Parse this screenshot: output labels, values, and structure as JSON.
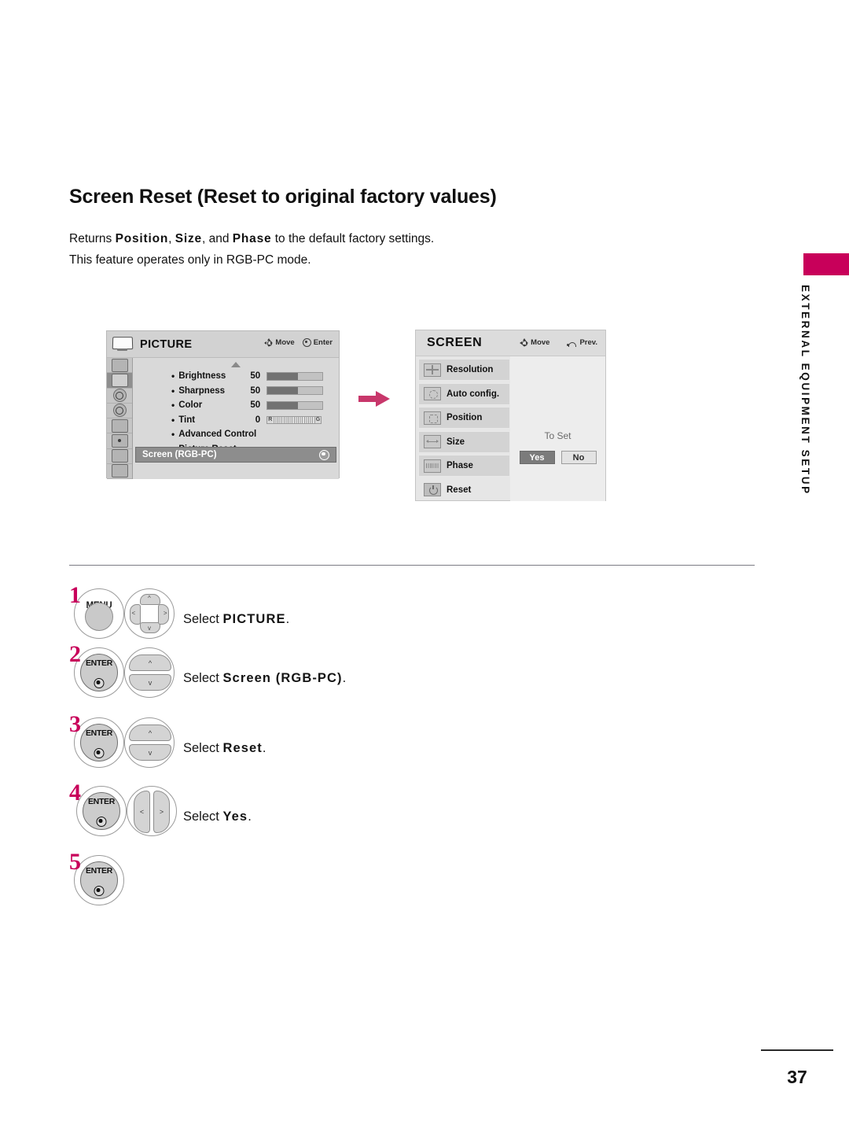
{
  "page": {
    "title": "Screen Reset (Reset to original factory values)",
    "intro_line1_prefix": "Returns ",
    "intro_bold_1": "Position",
    "intro_sep_1": ", ",
    "intro_bold_2": "Size",
    "intro_sep_2": ", and ",
    "intro_bold_3": "Phase",
    "intro_line1_suffix": " to the default factory settings.",
    "intro_line2": "This feature operates only in RGB-PC mode.",
    "running_head": "EXTERNAL EQUIPMENT SETUP",
    "page_number": "37",
    "accent_color": "#C8005A"
  },
  "osd_picture": {
    "title": "PICTURE",
    "tv_icon": "tv-icon",
    "hints": [
      {
        "icon": "dpad-icon",
        "label": "Move"
      },
      {
        "icon": "enter-icon",
        "label": "Enter"
      }
    ],
    "rail_icons": [
      "setup-icon",
      "picture-icon",
      "audio-icon",
      "time-icon",
      "option-icon",
      "lock-icon",
      "input-icon",
      "usb-icon"
    ],
    "rail_active_index": 1,
    "scroll_up_caret": "up-caret-icon",
    "rows": [
      {
        "label": "Brightness",
        "value": "50",
        "fill_pct": 55,
        "type": "bar"
      },
      {
        "label": "Sharpness",
        "value": "50",
        "fill_pct": 55,
        "type": "bar"
      },
      {
        "label": "Color",
        "value": "50",
        "fill_pct": 55,
        "type": "bar"
      },
      {
        "label": "Tint",
        "value": "0",
        "type": "tint",
        "left_mark": "R",
        "right_mark": "G"
      },
      {
        "label": "Advanced Control",
        "value": "",
        "type": "plain"
      },
      {
        "label": "Picture Reset",
        "value": "",
        "type": "plain"
      }
    ],
    "selected_row": "Screen (RGB-PC)"
  },
  "flow": {
    "arrow": "right-arrow-icon",
    "arrow_color": "#C8376B"
  },
  "osd_screen": {
    "title": "SCREEN",
    "hints": [
      {
        "icon": "dpad-icon",
        "label": "Move"
      },
      {
        "icon": "prev-icon",
        "label": "Prev."
      }
    ],
    "items": [
      {
        "label": "Resolution",
        "icon": "resolution-icon",
        "boxed": true
      },
      {
        "label": "Auto config.",
        "icon": "auto-config-icon",
        "boxed": true
      },
      {
        "label": "Position",
        "icon": "position-icon",
        "boxed": true
      },
      {
        "label": "Size",
        "icon": "size-icon",
        "boxed": true
      },
      {
        "label": "Phase",
        "icon": "phase-icon",
        "boxed": true
      },
      {
        "label": "Reset",
        "icon": "reset-icon",
        "boxed": false
      }
    ],
    "to_set_label": "To Set",
    "buttons": [
      {
        "label": "Yes",
        "selected": true
      },
      {
        "label": "No",
        "selected": false
      }
    ]
  },
  "steps": [
    {
      "number": "1",
      "button": "MENU",
      "button_type": "menu",
      "pad": "dpad4",
      "text_prefix": "Select ",
      "text_bold": "PICTURE",
      "text_suffix": "."
    },
    {
      "number": "2",
      "button": "ENTER",
      "button_type": "enter",
      "pad": "updown",
      "text_prefix": "Select ",
      "text_bold": "Screen (RGB-PC)",
      "text_suffix": "."
    },
    {
      "number": "3",
      "button": "ENTER",
      "button_type": "enter",
      "pad": "updown",
      "text_prefix": "Select ",
      "text_bold": "Reset",
      "text_suffix": "."
    },
    {
      "number": "4",
      "button": "ENTER",
      "button_type": "enter",
      "pad": "leftright",
      "text_prefix": "Select ",
      "text_bold": "Yes",
      "text_suffix": "."
    },
    {
      "number": "5",
      "button": "ENTER",
      "button_type": "enter",
      "pad": "none",
      "text_prefix": "",
      "text_bold": "",
      "text_suffix": ""
    }
  ]
}
